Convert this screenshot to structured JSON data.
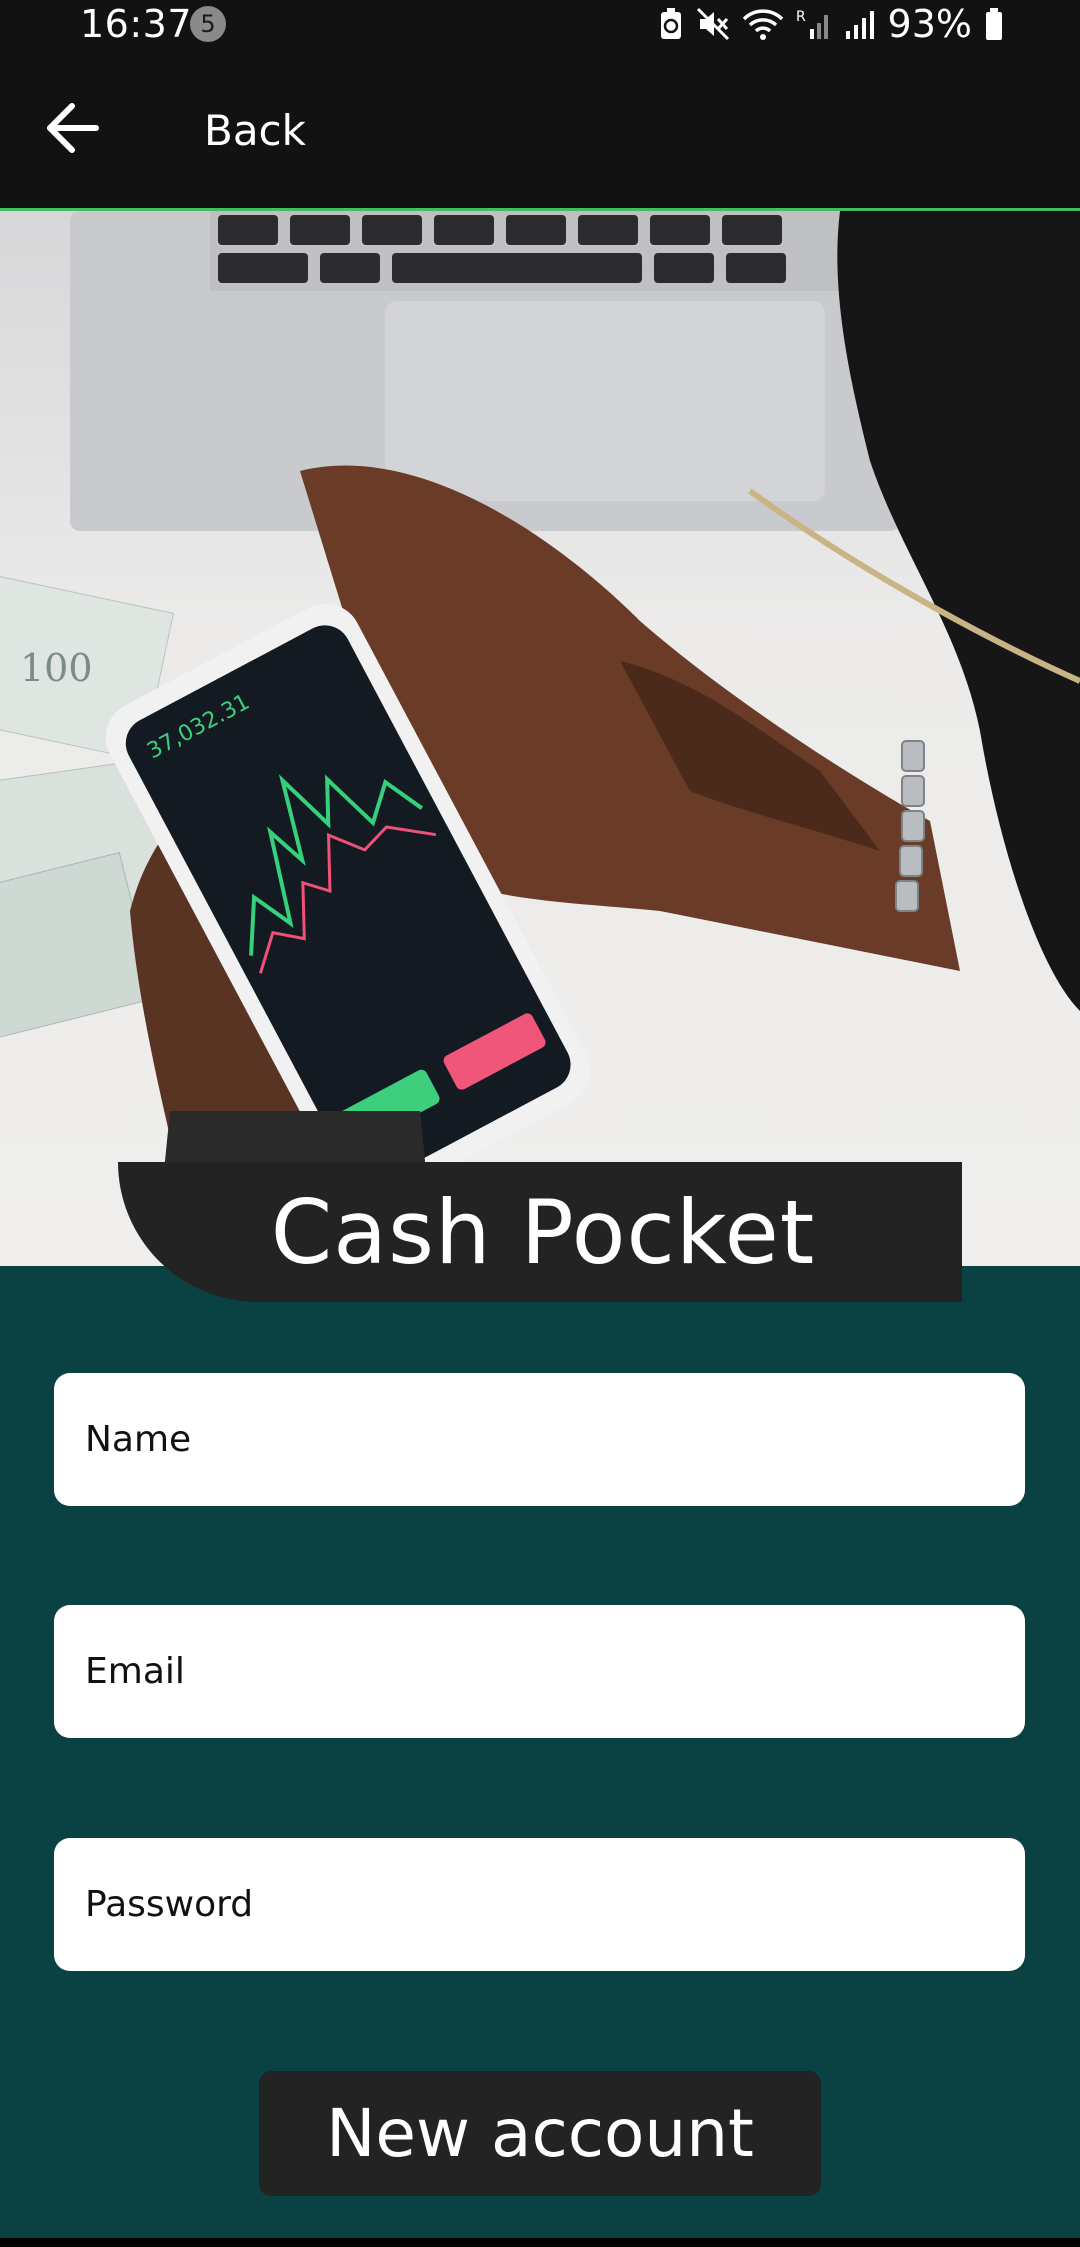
{
  "status_bar": {
    "time": "16:37",
    "notification_count": "5",
    "battery_percent": "93%",
    "icons": [
      "battery-saver-icon",
      "mute-icon",
      "wifi-icon",
      "signal-roaming-icon",
      "signal-icon",
      "battery-icon"
    ]
  },
  "app_bar": {
    "back_icon": "arrow-left-icon",
    "back_label": "Back",
    "accent_color": "#3fbf5f"
  },
  "hero": {
    "image": "hero-photo-hands-phone-trading-chart"
  },
  "app_title": "Cash Pocket",
  "form": {
    "name_placeholder": "Name",
    "email_placeholder": "Email",
    "password_placeholder": "Password"
  },
  "submit_label": "New account",
  "colors": {
    "background": "#0a4143",
    "dark_surface": "#232323",
    "field_background": "#ffffff"
  }
}
